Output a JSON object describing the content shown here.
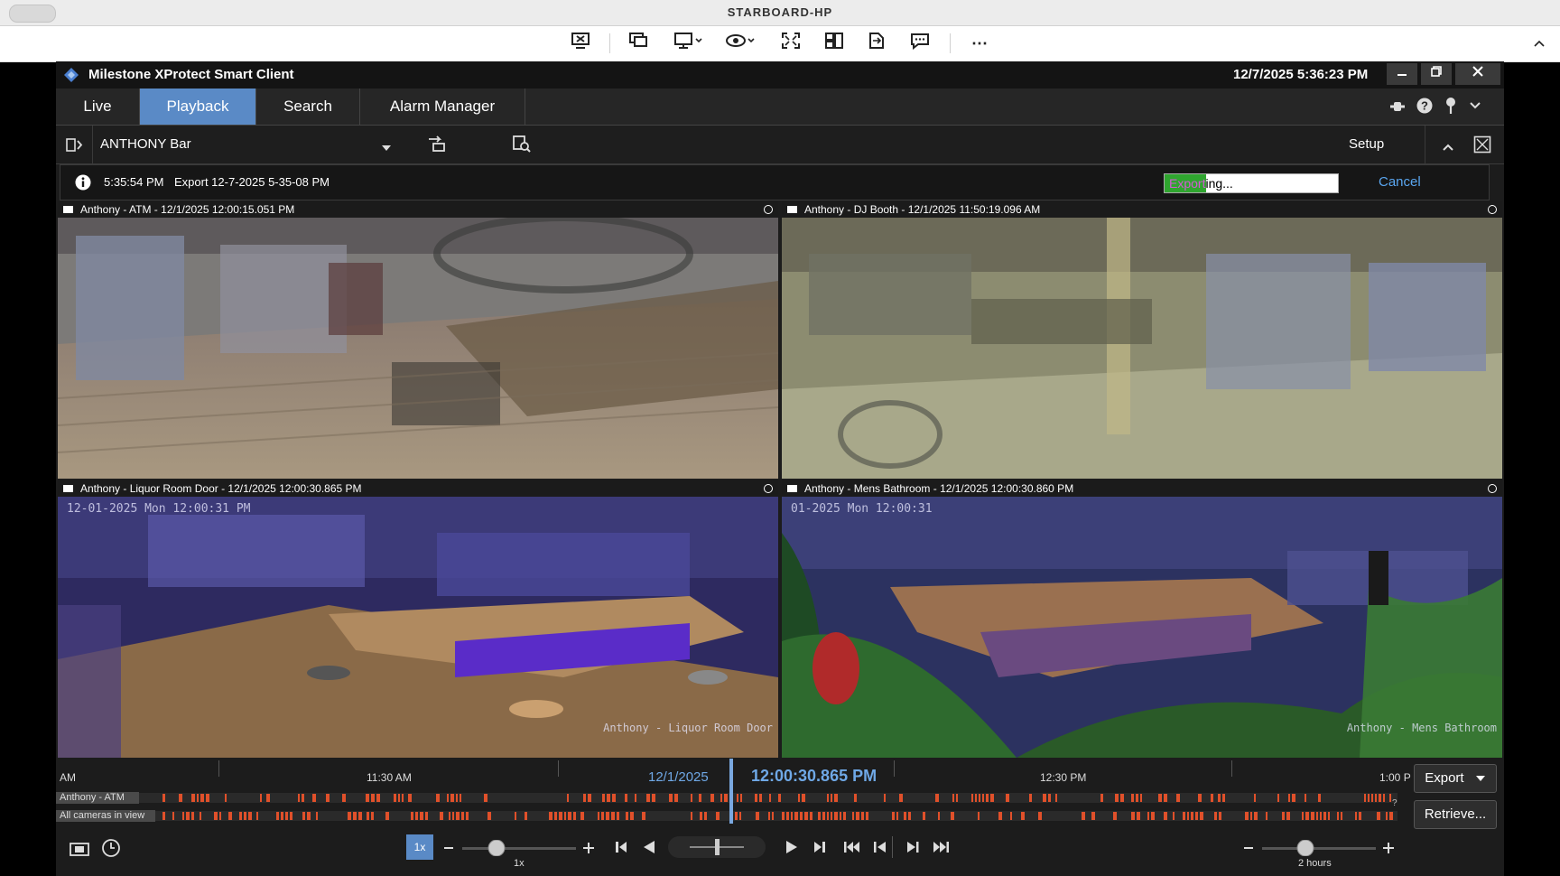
{
  "remote": {
    "title": "STARBOARD-HP"
  },
  "app": {
    "title": "Milestone XProtect Smart Client",
    "datetime": "12/7/2025 5:36:23 PM"
  },
  "tabs": [
    {
      "label": "Live"
    },
    {
      "label": "Playback"
    },
    {
      "label": "Search"
    },
    {
      "label": "Alarm Manager"
    }
  ],
  "viewbar": {
    "view_name": "ANTHONY Bar",
    "setup_label": "Setup"
  },
  "notice": {
    "time": "5:35:54 PM",
    "message": "Export 12-7-2025 5-35-08 PM",
    "progress_label": "Exporting...",
    "progress": 0.24,
    "cancel_label": "Cancel"
  },
  "cameras": [
    {
      "header": "Anthony - ATM - 12/1/2025 12:00:15.051 PM",
      "overlay": "",
      "label": ""
    },
    {
      "header": "Anthony - DJ Booth - 12/1/2025 11:50:19.096 AM",
      "overlay": "",
      "label": ""
    },
    {
      "header": "Anthony - Liquor Room Door - 12/1/2025 12:00:30.865 PM",
      "overlay": "12-01-2025 Mon 12:00:31 PM",
      "label": "Anthony - Liquor Room Door"
    },
    {
      "header": "Anthony - Mens Bathroom - 12/1/2025 12:00:30.860 PM",
      "overlay": "01-2025 Mon 12:00:31",
      "label": "Anthony - Mens Bathroom"
    }
  ],
  "timeline": {
    "ticks": [
      "AM",
      "11:30 AM",
      "12:30 PM",
      "1:00 P"
    ],
    "date": "12/1/2025",
    "current_time": "12:00:30.865 PM",
    "rows": [
      "Anthony - ATM",
      "All cameras in view"
    ],
    "help": "?",
    "speed_badge": "1x",
    "speed_label": "1x",
    "span_label": "2 hours",
    "export_label": "Export",
    "retrieve_label": "Retrieve..."
  },
  "colors": {
    "accent": "#5a8ac6",
    "progress_green": "#2fa52f",
    "timeline_event": "#e0502a",
    "time_blue": "#6fa8e6"
  }
}
